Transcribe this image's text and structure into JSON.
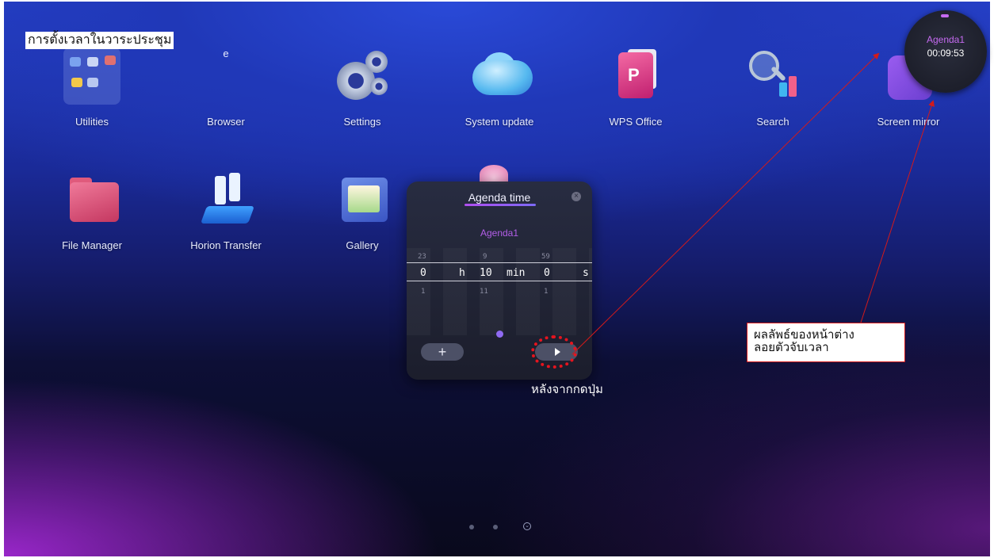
{
  "annotation": {
    "top_caption": "การตั้งเวลาในวาระประชุม",
    "after_press_note": "หลังจากกดปุ่ม",
    "result_box_line1": "ผลลัพธ์ของหน้าต่าง",
    "result_box_line2": "ลอยตัวจับเวลา",
    "arrow_color": "#d31a1a"
  },
  "apps_row1": [
    {
      "label": "Utilities",
      "icon": "utilities-icon"
    },
    {
      "label": "Browser",
      "icon": "browser-icon"
    },
    {
      "label": "Settings",
      "icon": "settings-icon"
    },
    {
      "label": "System update",
      "icon": "system-update-icon"
    },
    {
      "label": "WPS Office",
      "icon": "wps-office-icon"
    },
    {
      "label": "Search",
      "icon": "search-icon"
    },
    {
      "label": "Screen mirror",
      "icon": "screen-mirror-icon"
    }
  ],
  "apps_row2": [
    {
      "label": "File Manager",
      "icon": "file-manager-icon"
    },
    {
      "label": "Horion Transfer",
      "icon": "horion-transfer-icon"
    },
    {
      "label": "Gallery",
      "icon": "gallery-icon"
    }
  ],
  "agenda_dialog": {
    "title": "Agenda time",
    "agenda_name": "Agenda1",
    "hours": {
      "prev": "23",
      "value": "0",
      "next": "1",
      "unit": "h"
    },
    "minutes": {
      "prev": "9",
      "value": "10",
      "next": "11",
      "unit": "min"
    },
    "seconds": {
      "prev": "59",
      "value": "0",
      "next": "1",
      "unit": "s"
    },
    "add_label": "+",
    "accent": "#b35ee8"
  },
  "floating_timer": {
    "name": "Agenda1",
    "time": "00:09:53"
  },
  "pager": {
    "pages": 3,
    "current": 3
  }
}
